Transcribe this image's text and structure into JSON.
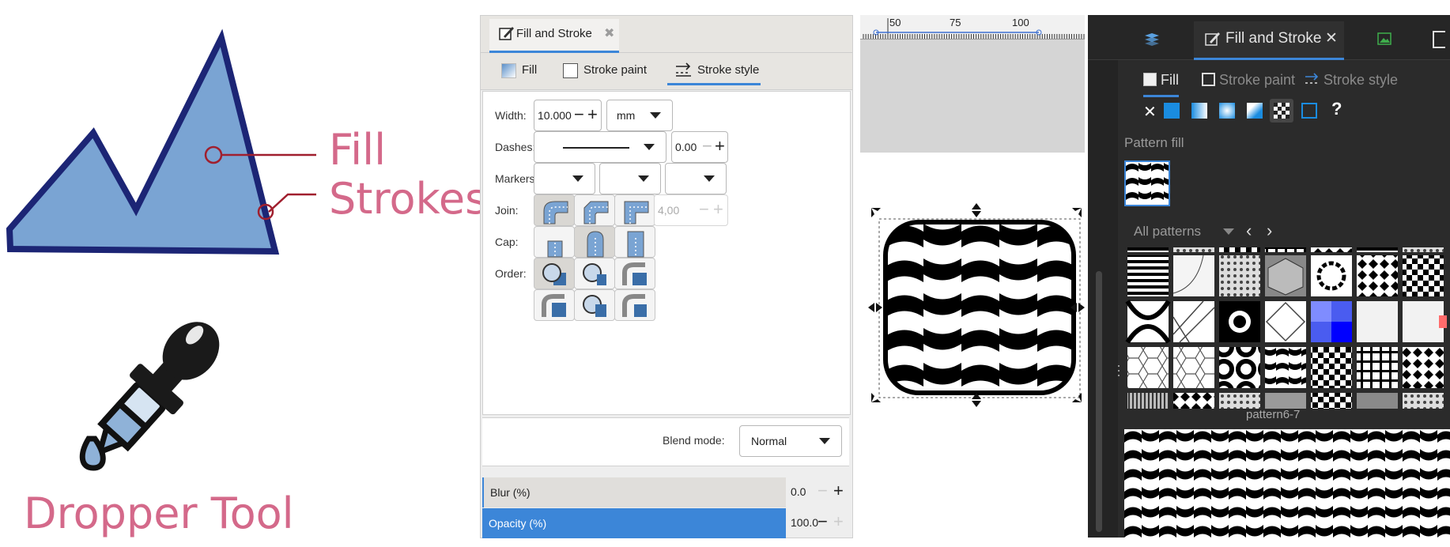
{
  "illustration": {
    "label_fill": "Fill",
    "label_strokes": "Strokes",
    "label_dropper": "Dropper Tool",
    "accent_color": "#d4698a",
    "fill_color": "#7aa4d3",
    "stroke_color": "#1c2575"
  },
  "light_dialog": {
    "doc_tab": {
      "label": "Fill and Stroke",
      "close_glyph": "✖"
    },
    "tabs": [
      {
        "label": "Fill"
      },
      {
        "label": "Stroke paint"
      },
      {
        "label": "Stroke style",
        "active": true
      }
    ],
    "width": {
      "label": "Width:",
      "value": "10.000",
      "unit": "mm"
    },
    "dashes": {
      "label": "Dashes:",
      "offset": "0.00"
    },
    "markers": {
      "label": "Markers:"
    },
    "join": {
      "label": "Join:",
      "miter_limit": "4,00"
    },
    "cap": {
      "label": "Cap:"
    },
    "order": {
      "label": "Order:"
    },
    "blend": {
      "label": "Blend mode:",
      "value": "Normal"
    },
    "blur": {
      "label": "Blur (%)",
      "value": "0.0"
    },
    "opacity": {
      "label": "Opacity (%)",
      "value": "100.0",
      "level": 1.0
    }
  },
  "ruler": {
    "ticks": [
      "50",
      "75",
      "100"
    ]
  },
  "dark_dialog": {
    "tab_label": "Fill and Stroke",
    "subtabs": [
      "Fill",
      "Stroke paint",
      "Stroke style"
    ],
    "fill_modes": [
      "none",
      "flat",
      "linear",
      "radial",
      "mesh",
      "pattern",
      "swatch",
      "unset"
    ],
    "unset_glyph": "?",
    "section_label": "Pattern fill",
    "filter": {
      "value": "All patterns"
    },
    "selected_pattern": "pattern6-7",
    "colors": {
      "background": "#2b2b2b",
      "accent": "#3c86d8"
    }
  }
}
